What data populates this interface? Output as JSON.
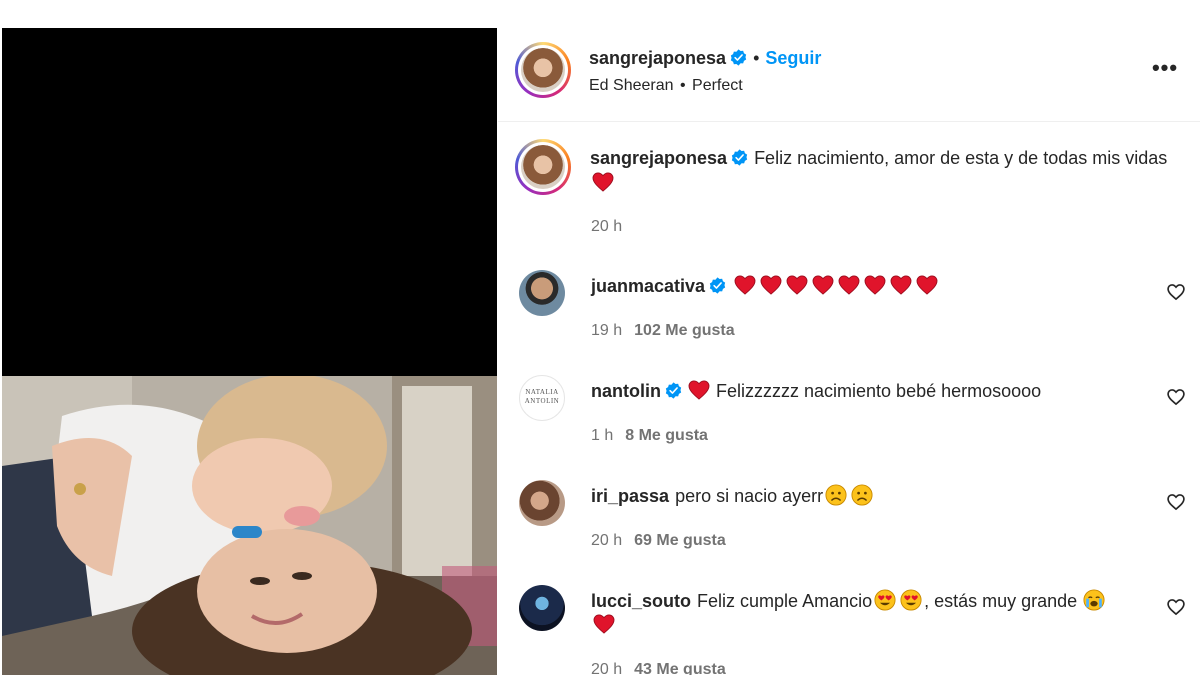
{
  "post": {
    "username": "sangrejaponesa",
    "follow_label": "Seguir",
    "separator": "•",
    "audio_artist": "Ed Sheeran",
    "audio_song": "Perfect",
    "more_label": "•••"
  },
  "caption": {
    "username": "sangrejaponesa",
    "text": "Feliz nacimiento, amor de esta y de todas mis vidas",
    "time": "20 h"
  },
  "comments": [
    {
      "username": "juanmacativa",
      "verified": true,
      "text": "",
      "emojis": [
        "red-heart",
        "red-heart",
        "red-heart",
        "red-heart",
        "red-heart",
        "red-heart",
        "red-heart",
        "red-heart"
      ],
      "time": "19 h",
      "likes": "102 Me gusta"
    },
    {
      "username": "nantolin",
      "verified": true,
      "text": "Felizzzzzz nacimiento bebé hermosoooo",
      "time": "1 h",
      "likes": "8 Me gusta",
      "avatar_text": "NATALIA ANTOLIN"
    },
    {
      "username": "iri_passa",
      "verified": false,
      "text": "pero si nacio ayerr",
      "time": "20 h",
      "likes": "69 Me gusta"
    },
    {
      "username": "lucci_souto",
      "verified": false,
      "text_a": "Feliz cumple Amancio",
      "text_b": ", estás muy grande",
      "time": "20 h",
      "likes": "43 Me gusta"
    }
  ],
  "colors": {
    "follow": "#0095f6",
    "verified": "#0095f6",
    "secondary_text": "#737373",
    "heart": "#e0142b"
  }
}
